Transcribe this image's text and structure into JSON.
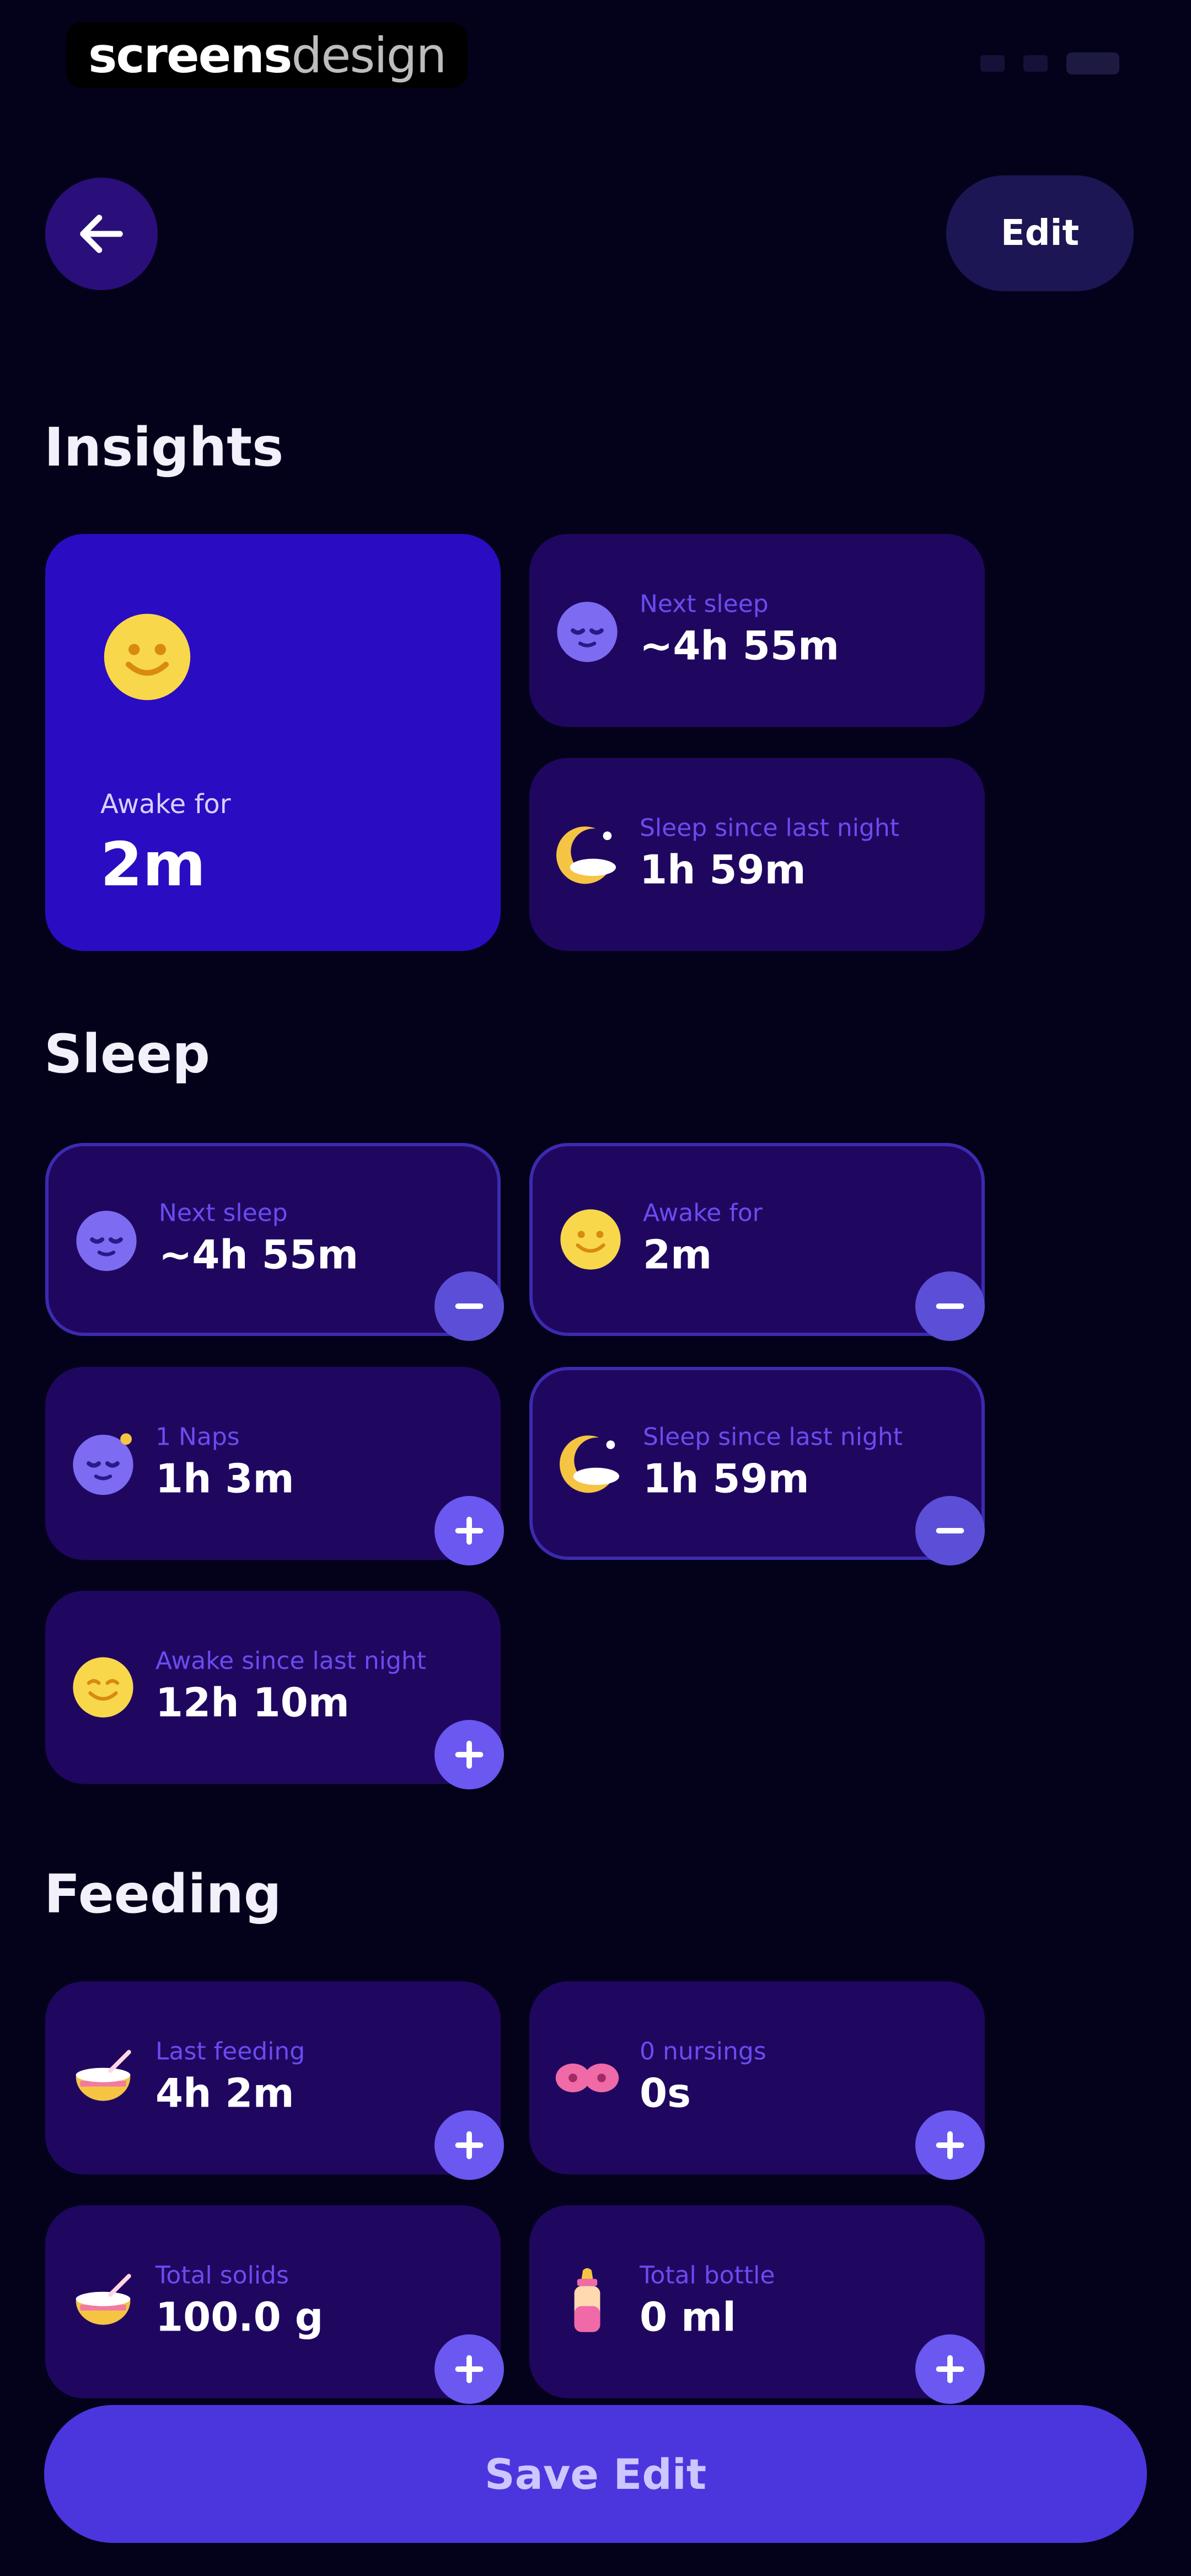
{
  "status_bar": {
    "watermark_part1": "screens",
    "watermark_part2": "design"
  },
  "header": {
    "back_icon": "arrow-left-icon",
    "edit_label": "Edit"
  },
  "sections": {
    "insights": {
      "title": "Insights"
    },
    "sleep": {
      "title": "Sleep"
    },
    "feeding": {
      "title": "Feeding"
    }
  },
  "insights": {
    "awake": {
      "label": "Awake for",
      "value": "2m",
      "icon": "smiley-sun-icon"
    },
    "next_sleep": {
      "label": "Next sleep",
      "value": "~4h 55m",
      "icon": "sleeping-face-icon"
    },
    "sleep_since": {
      "label": "Sleep since last night",
      "value": "1h 59m",
      "icon": "moon-icon"
    }
  },
  "sleep": {
    "next_sleep": {
      "label": "Next sleep",
      "value": "~4h 55m",
      "icon": "sleeping-face-icon",
      "action": "minus"
    },
    "awake_for": {
      "label": "Awake for",
      "value": "2m",
      "icon": "smiley-sun-icon",
      "action": "minus"
    },
    "naps": {
      "label": "1 Naps",
      "value": "1h 3m",
      "icon": "sleeping-face-icon",
      "action": "plus"
    },
    "sleep_since": {
      "label": "Sleep since last night",
      "value": "1h 59m",
      "icon": "moon-icon",
      "action": "minus"
    },
    "awake_since": {
      "label": "Awake since last night",
      "value": "12h 10m",
      "icon": "smiley-sun-icon",
      "action": "plus"
    }
  },
  "feeding": {
    "last_feeding": {
      "label": "Last feeding",
      "value": "4h 2m",
      "icon": "food-bowl-icon",
      "action": "plus"
    },
    "nursings": {
      "label": "0 nursings",
      "value": "0s",
      "icon": "nursing-icon",
      "action": "plus"
    },
    "total_solids": {
      "label": "Total solids",
      "value": "100.0 g",
      "icon": "food-bowl-icon",
      "action": "plus"
    },
    "total_bottle": {
      "label": "Total bottle",
      "value": "0 ml",
      "icon": "baby-bottle-icon",
      "action": "plus"
    }
  },
  "footer": {
    "save_label": "Save Edit"
  },
  "colors": {
    "background": "#04021a",
    "card": "#1f0760",
    "highlight_card": "#2a0cc2",
    "accent": "#4b36dd",
    "label": "#6a4cf0"
  }
}
